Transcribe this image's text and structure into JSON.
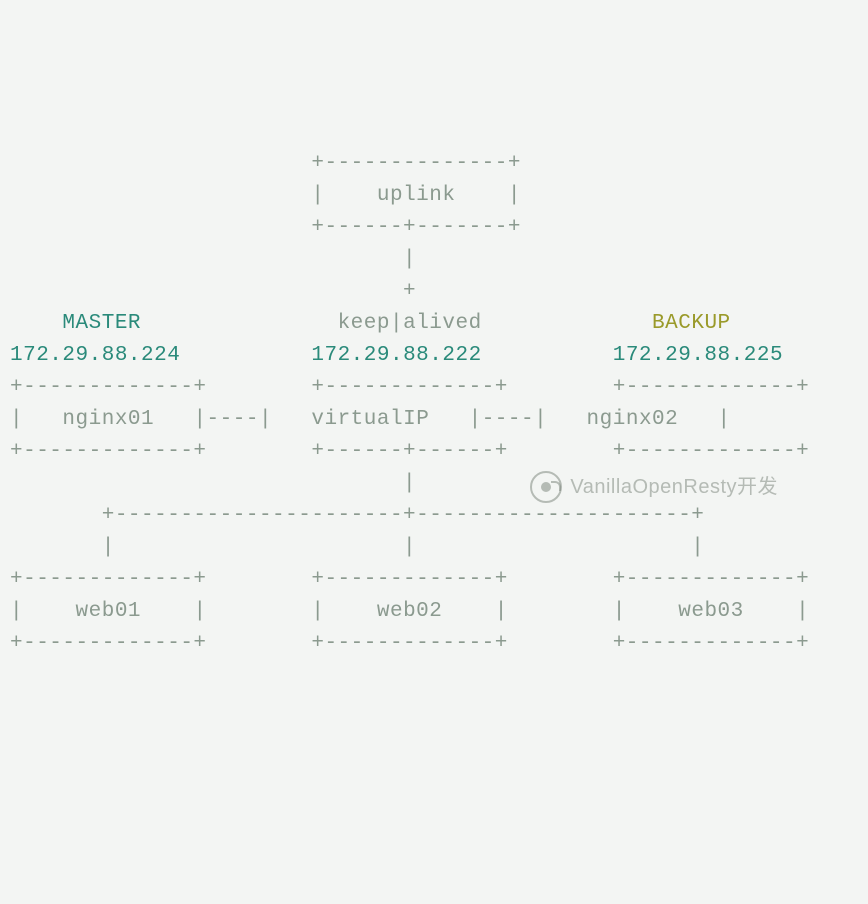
{
  "diagram": {
    "uplink": "uplink",
    "keepalived": "keep|alived",
    "master_label": "MASTER",
    "backup_label": "BACKUP",
    "master_ip": "172.29.88.224",
    "virtual_ip": "172.29.88.222",
    "backup_ip": "172.29.88.225",
    "nginx01": "nginx01",
    "virtualip_box": "virtualIP",
    "nginx02": "nginx02",
    "web01": "web01",
    "web02": "web02",
    "web03": "web03"
  },
  "watermark": "VanillaOpenResty开发"
}
